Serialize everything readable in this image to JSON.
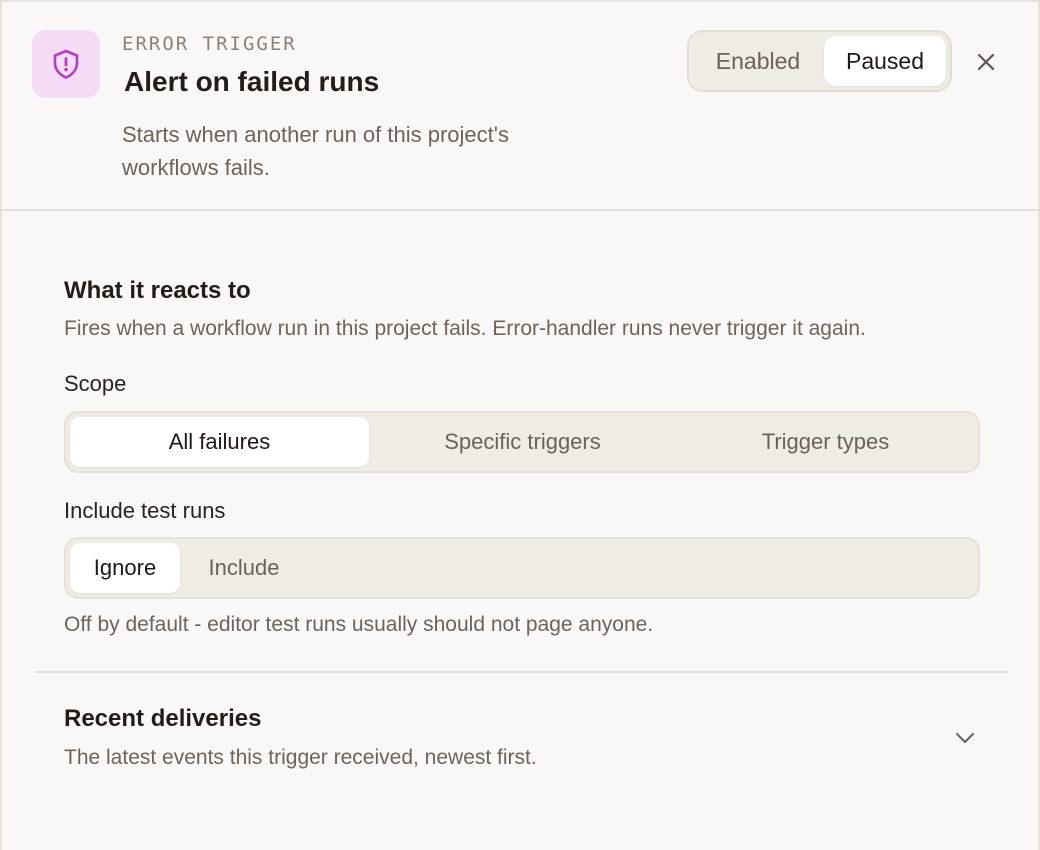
{
  "header": {
    "eyebrow": "ERROR TRIGGER",
    "title": "Alert on failed runs",
    "subtitle": "Starts when another run of this project's workflows fails.",
    "icon": "shield-alert-icon",
    "status": {
      "options": [
        "Enabled",
        "Paused"
      ],
      "selected": "Paused"
    },
    "close_icon": "close-icon"
  },
  "reacts": {
    "title": "What it reacts to",
    "description": "Fires when a workflow run in this project fails. Error-handler runs never trigger it again.",
    "scope": {
      "label": "Scope",
      "options": [
        "All failures",
        "Specific triggers",
        "Trigger types"
      ],
      "selected": "All failures"
    },
    "test_runs": {
      "label": "Include test runs",
      "options": [
        "Ignore",
        "Include"
      ],
      "selected": "Ignore",
      "hint": "Off by default - editor test runs usually should not page anyone."
    }
  },
  "deliveries": {
    "title": "Recent deliveries",
    "description": "The latest events this trigger received, newest first.",
    "expand_icon": "chevron-down-icon"
  },
  "colors": {
    "accent": "#b13fc0",
    "icon_bg": "#f4dcf6",
    "background": "#faf8f6",
    "segment_bg": "#efebe5"
  }
}
